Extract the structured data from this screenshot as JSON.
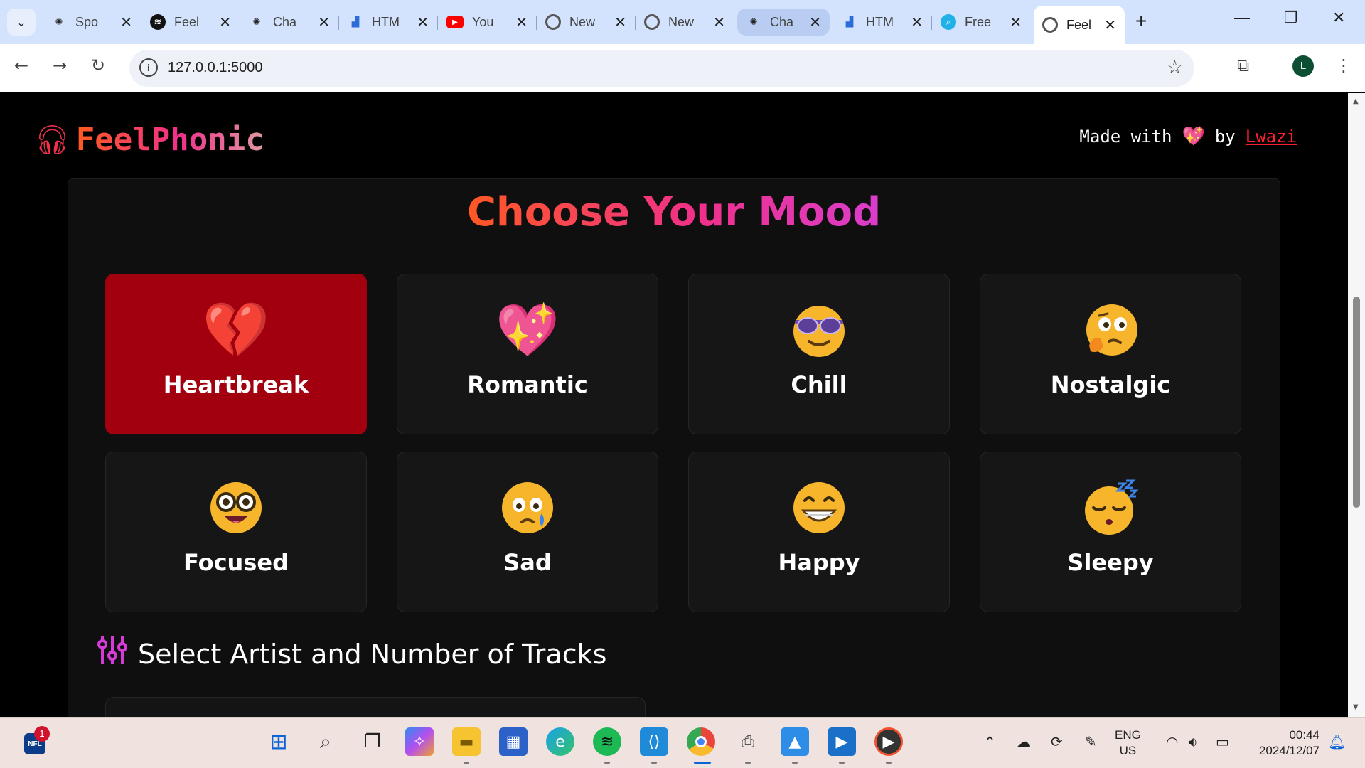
{
  "browser": {
    "tabs": [
      {
        "title": "Spo",
        "favicon": "chatgpt-icon"
      },
      {
        "title": "Feel",
        "favicon": "spotify-icon"
      },
      {
        "title": "Cha",
        "favicon": "chatgpt-icon"
      },
      {
        "title": "HTM",
        "favicon": "chart-icon"
      },
      {
        "title": "You",
        "favicon": "youtube-icon"
      },
      {
        "title": "New",
        "favicon": "chrome-icon"
      },
      {
        "title": "New",
        "favicon": "chrome-icon"
      },
      {
        "title": "Cha",
        "favicon": "chatgpt-icon"
      },
      {
        "title": "HTM",
        "favicon": "chart-icon"
      },
      {
        "title": "Free",
        "favicon": "search-icon"
      },
      {
        "title": "Feel",
        "favicon": "globe-icon"
      }
    ],
    "url": "127.0.0.1:5000",
    "profile_initial": "L"
  },
  "header": {
    "brand": "FeelPhonic",
    "credit_prefix": "Made with",
    "credit_by": "by",
    "credit_author": "Lwazi"
  },
  "main": {
    "title": "Choose Your Mood",
    "moods": [
      {
        "label": "Heartbreak",
        "icon": "broken-heart-icon",
        "selected": true
      },
      {
        "label": "Romantic",
        "icon": "sparkling-heart-icon",
        "selected": false
      },
      {
        "label": "Chill",
        "icon": "sunglasses-face-icon",
        "selected": false
      },
      {
        "label": "Nostalgic",
        "icon": "thinking-face-icon",
        "selected": false
      },
      {
        "label": "Focused",
        "icon": "nerd-face-icon",
        "selected": false
      },
      {
        "label": "Sad",
        "icon": "crying-face-icon",
        "selected": false
      },
      {
        "label": "Happy",
        "icon": "grinning-face-icon",
        "selected": false
      },
      {
        "label": "Sleepy",
        "icon": "sleeping-face-icon",
        "selected": false
      }
    ],
    "section_title": "Select Artist and Number of Tracks"
  },
  "taskbar": {
    "nfl_badge": "1",
    "nfl_label": "NFL",
    "lang_line1": "ENG",
    "lang_line2": "US",
    "time": "00:44",
    "date": "2024/12/07"
  },
  "colors": {
    "accent_orange": "#ff5a1f",
    "accent_pink": "#f0308a",
    "accent_magenta": "#d63ad8",
    "selected_card": "#a3000f",
    "author_link": "#ff1e2d"
  }
}
